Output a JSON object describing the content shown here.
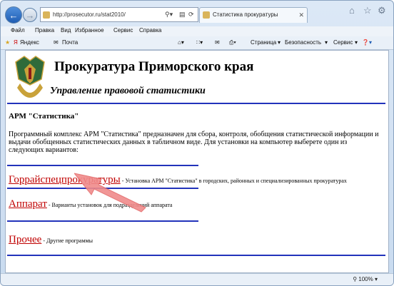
{
  "browser": {
    "url": "http://prosecutor.ru/stat2010/",
    "tab_title": "Статистика прокуратуры",
    "menu": [
      "Файл",
      "Правка",
      "Вид",
      "Избранное",
      "Сервис",
      "Справка"
    ],
    "favorites": [
      "Яндекс",
      "Почта"
    ],
    "commands": [
      "Страница",
      "Безопасность",
      "Сервис"
    ],
    "zoom": "100%"
  },
  "page": {
    "title": "Прокуратура Приморского края",
    "subtitle": "Управление правовой статистики",
    "heading": "АРМ \"Статистика\"",
    "description": "Программный комплекс АРМ \"Статистика\" предназначен для сбора, контроля, обобщения статистической информации и выдачи обобщенных статистических данных в табличном виде. Для установки на компьютер выберете один из следующих вариантов:",
    "options": [
      {
        "link": "Горрайспецпрокуратуры",
        "desc": " - Установка АРМ \"Статистика\" в городских, районных и специализированных прокуратурах"
      },
      {
        "link": "Аппарат",
        "desc": " - Варианты установок для подразделений аппарата"
      },
      {
        "link": "Прочее",
        "desc": " - Другие программы"
      }
    ]
  }
}
